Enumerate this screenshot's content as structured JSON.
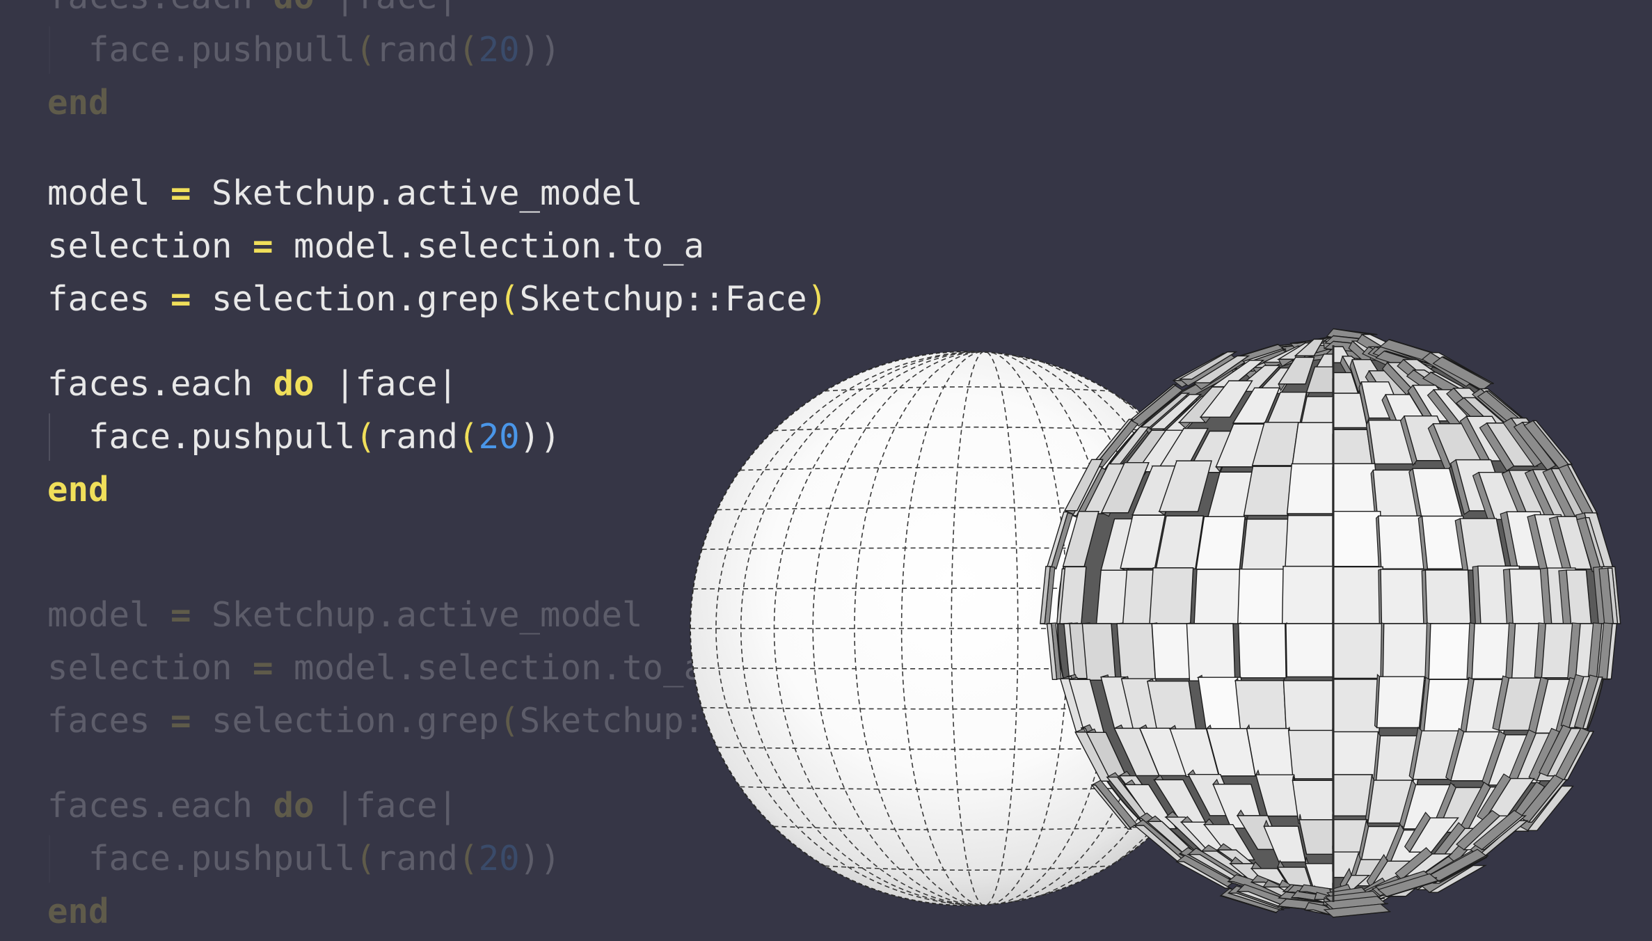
{
  "code_top": {
    "lines": [
      {
        "indent": "",
        "tokens": [
          {
            "text": "faces.each ",
            "kind": "plain"
          },
          {
            "text": "do",
            "kind": "kw"
          },
          {
            "text": " |face|",
            "kind": "plain"
          }
        ]
      },
      {
        "indent": "  ",
        "tokens": [
          {
            "text": "face.pushpull",
            "kind": "plain"
          },
          {
            "text": "(",
            "kind": "paren"
          },
          {
            "text": "rand",
            "kind": "plain"
          },
          {
            "text": "(",
            "kind": "paren"
          },
          {
            "text": "20",
            "kind": "num"
          },
          {
            "text": "))",
            "kind": "plain"
          }
        ]
      },
      {
        "indent": "",
        "tokens": [
          {
            "text": "end",
            "kind": "kw"
          }
        ]
      }
    ]
  },
  "code_main": {
    "lines": [
      {
        "indent": "",
        "tokens": [
          {
            "text": "model ",
            "kind": "plain"
          },
          {
            "text": "=",
            "kind": "op"
          },
          {
            "text": " Sketchup.active_model",
            "kind": "plain"
          }
        ]
      },
      {
        "indent": "",
        "tokens": [
          {
            "text": "selection ",
            "kind": "plain"
          },
          {
            "text": "=",
            "kind": "op"
          },
          {
            "text": " model.selection.to_a",
            "kind": "plain"
          }
        ]
      },
      {
        "indent": "",
        "tokens": [
          {
            "text": "faces ",
            "kind": "plain"
          },
          {
            "text": "=",
            "kind": "op"
          },
          {
            "text": " selection.grep",
            "kind": "plain"
          },
          {
            "text": "(",
            "kind": "paren"
          },
          {
            "text": "Sketchup::Face",
            "kind": "plain"
          },
          {
            "text": ")",
            "kind": "paren"
          }
        ]
      },
      {
        "blank": true
      },
      {
        "indent": "",
        "tokens": [
          {
            "text": "faces.each ",
            "kind": "plain"
          },
          {
            "text": "do",
            "kind": "kw"
          },
          {
            "text": " |face|",
            "kind": "plain"
          }
        ]
      },
      {
        "indent": "  ",
        "tokens": [
          {
            "text": "face.pushpull",
            "kind": "plain"
          },
          {
            "text": "(",
            "kind": "paren"
          },
          {
            "text": "rand",
            "kind": "plain"
          },
          {
            "text": "(",
            "kind": "paren"
          },
          {
            "text": "20",
            "kind": "num"
          },
          {
            "text": "))",
            "kind": "plain"
          }
        ]
      },
      {
        "indent": "",
        "tokens": [
          {
            "text": "end",
            "kind": "kw"
          }
        ]
      }
    ]
  },
  "code_bottom": {
    "lines": [
      {
        "indent": "",
        "tokens": [
          {
            "text": "model ",
            "kind": "plain"
          },
          {
            "text": "=",
            "kind": "op"
          },
          {
            "text": " Sketchup.active_model",
            "kind": "plain"
          }
        ]
      },
      {
        "indent": "",
        "tokens": [
          {
            "text": "selection ",
            "kind": "plain"
          },
          {
            "text": "=",
            "kind": "op"
          },
          {
            "text": " model.selection.to_a",
            "kind": "plain"
          }
        ]
      },
      {
        "indent": "",
        "tokens": [
          {
            "text": "faces ",
            "kind": "plain"
          },
          {
            "text": "=",
            "kind": "op"
          },
          {
            "text": " selection.grep",
            "kind": "plain"
          },
          {
            "text": "(",
            "kind": "paren"
          },
          {
            "text": "Sketchup::Face",
            "kind": "plain"
          },
          {
            "text": ")",
            "kind": "paren"
          }
        ]
      },
      {
        "blank": true
      },
      {
        "indent": "",
        "tokens": [
          {
            "text": "faces.each ",
            "kind": "plain"
          },
          {
            "text": "do",
            "kind": "kw"
          },
          {
            "text": " |face|",
            "kind": "plain"
          }
        ]
      },
      {
        "indent": "  ",
        "tokens": [
          {
            "text": "face.pushpull",
            "kind": "plain"
          },
          {
            "text": "(",
            "kind": "paren"
          },
          {
            "text": "rand",
            "kind": "plain"
          },
          {
            "text": "(",
            "kind": "paren"
          },
          {
            "text": "20",
            "kind": "num"
          },
          {
            "text": "))",
            "kind": "plain"
          }
        ]
      },
      {
        "indent": "",
        "tokens": [
          {
            "text": "end",
            "kind": "kw"
          }
        ]
      }
    ]
  },
  "colors": {
    "background": "#363646",
    "text": "#e8e8e8",
    "keyword": "#f0df5a",
    "number": "#4a96e8",
    "indent_guide": "#50505e"
  },
  "illustration": {
    "smooth_sphere": "smooth-sphere-icon",
    "pushpulled_sphere": "pushpulled-sphere-icon"
  }
}
